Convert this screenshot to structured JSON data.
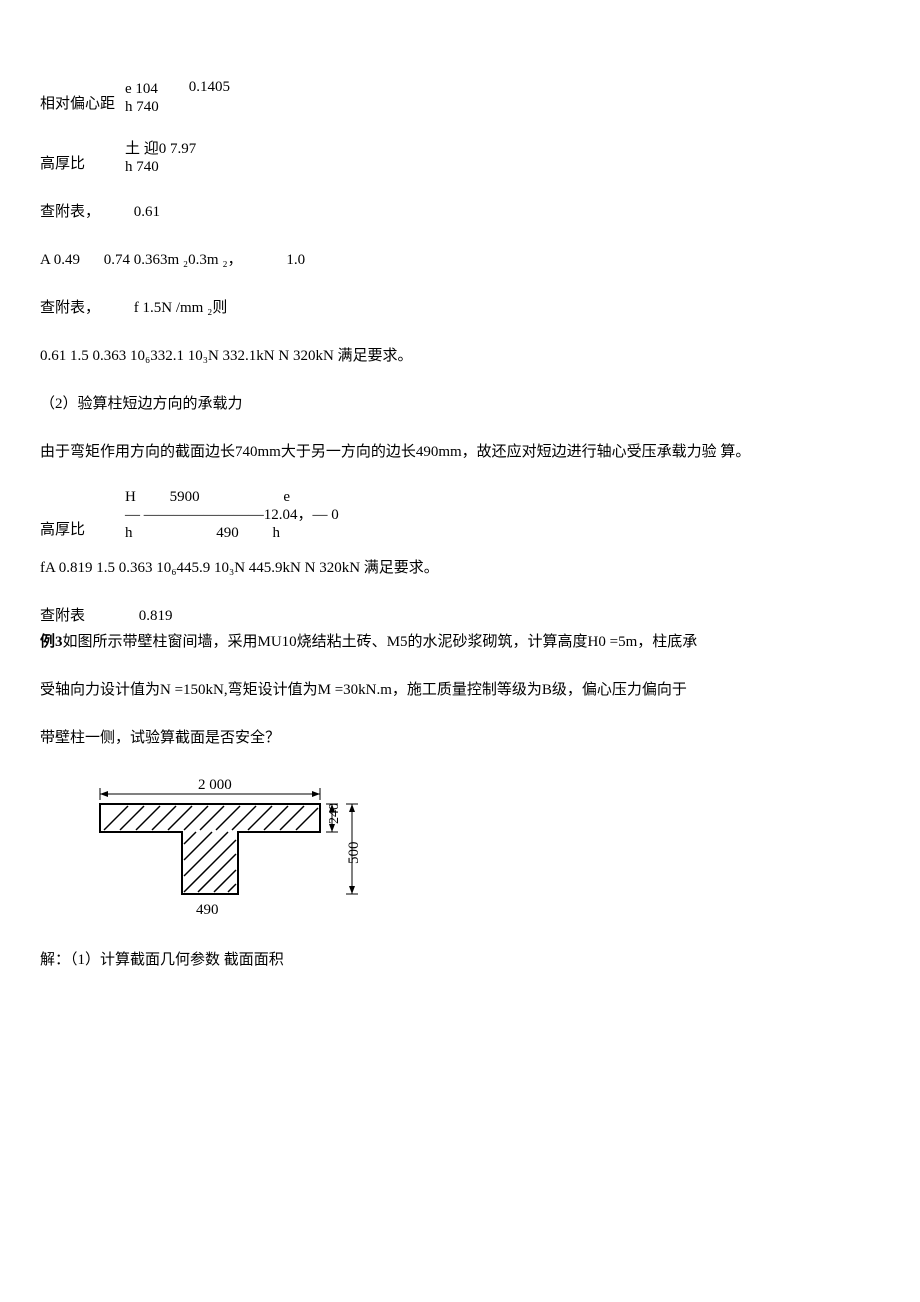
{
  "line1": {
    "label": "相对偏心距",
    "frac_top": "e 104",
    "frac_bot": "h 740",
    "result": "0.1405"
  },
  "line2": {
    "label": "高厚比",
    "frac_top": "土 迎0 7.97",
    "frac_bot": "h 740"
  },
  "line3": {
    "label": "查附表，",
    "value": "0.61"
  },
  "line4": {
    "a": "A 0.49",
    "b": "0.74 0.363m ₂0.3m ₂，",
    "c": "1.0"
  },
  "line5": {
    "label": "查附表，",
    "value": "f 1.5N /mm ₂则"
  },
  "line6": "0.61 1.5 0.363 10₆332.1 10₃N 332.1kN N 320kN 满足要求。",
  "line7": "（2）验算柱短边方向的承载力",
  "line8": "由于弯矩作用方向的截面边长740mm大于另一方向的边长490mm，故还应对短边进行轴心受压承载力验 算。",
  "line9": {
    "label": "高厚比",
    "frac_top1": "H",
    "frac_mid": "— ————————12.04，— 0",
    "frac_bot1": "h",
    "num_top": "5900",
    "num_bot": "490",
    "e_top": "e",
    "e_bot": "h"
  },
  "line10": "  fA 0.819 1.5 0.363 10₆445.9 10₃N 445.9kN N 320kN 满足要求。",
  "line11": {
    "label": "查附表",
    "value": "0.819"
  },
  "line12": {
    "bold": "例3",
    "rest": "如图所示带壁柱窗间墙，采用MU10烧结粘土砖、M5的水泥砂浆砌筑，计算高度H0 =5m，柱底承"
  },
  "line13": "受轴向力设计值为N =150kN,弯矩设计值为M =30kN.m，施工质量控制等级为B级，偏心压力偏向于",
  "line14": "带壁柱一侧，试验算截面是否安全？",
  "diagram": {
    "top_dim": "2 000",
    "right_top": "240",
    "right_height": "500",
    "bottom": "490"
  },
  "line15": "解：（1）计算截面几何参数 截面面积"
}
